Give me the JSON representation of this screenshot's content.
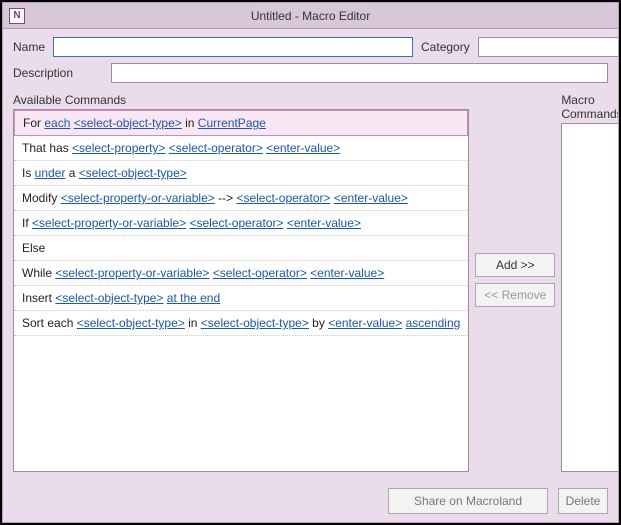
{
  "window": {
    "title": "Untitled - Macro Editor",
    "icon_letter": "N"
  },
  "form": {
    "name_label": "Name",
    "category_label": "Category",
    "description_label": "Description",
    "name_value": "",
    "category_value": "",
    "description_value": ""
  },
  "available_header": "Available Commands",
  "macro_header": "Macro Commands",
  "buttons": {
    "add": "Add >>",
    "remove": "<< Remove",
    "share": "Share on Macroland",
    "delete": "Delete"
  },
  "commands": [
    {
      "selected": true,
      "parts": [
        {
          "t": "text",
          "v": "For "
        },
        {
          "t": "link",
          "v": "each"
        },
        {
          "t": "text",
          "v": " "
        },
        {
          "t": "ph",
          "v": "<select-object-type>"
        },
        {
          "t": "text",
          "v": " in "
        },
        {
          "t": "link",
          "v": "CurrentPage"
        }
      ]
    },
    {
      "parts": [
        {
          "t": "text",
          "v": "That has "
        },
        {
          "t": "ph",
          "v": "<select-property>"
        },
        {
          "t": "text",
          "v": " "
        },
        {
          "t": "ph",
          "v": "<select-operator>"
        },
        {
          "t": "text",
          "v": " "
        },
        {
          "t": "ph",
          "v": "<enter-value>"
        }
      ]
    },
    {
      "parts": [
        {
          "t": "text",
          "v": "Is "
        },
        {
          "t": "link",
          "v": "under"
        },
        {
          "t": "text",
          "v": " a "
        },
        {
          "t": "ph",
          "v": "<select-object-type>"
        }
      ]
    },
    {
      "parts": [
        {
          "t": "text",
          "v": "Modify "
        },
        {
          "t": "ph",
          "v": "<select-property-or-variable>"
        },
        {
          "t": "text",
          "v": " --> "
        },
        {
          "t": "ph",
          "v": "<select-operator>"
        },
        {
          "t": "text",
          "v": " "
        },
        {
          "t": "ph",
          "v": "<enter-value>"
        }
      ]
    },
    {
      "parts": [
        {
          "t": "text",
          "v": "If "
        },
        {
          "t": "ph",
          "v": "<select-property-or-variable>"
        },
        {
          "t": "text",
          "v": " "
        },
        {
          "t": "ph",
          "v": "<select-operator>"
        },
        {
          "t": "text",
          "v": " "
        },
        {
          "t": "ph",
          "v": "<enter-value>"
        }
      ]
    },
    {
      "parts": [
        {
          "t": "text",
          "v": "Else"
        }
      ]
    },
    {
      "parts": [
        {
          "t": "text",
          "v": "While "
        },
        {
          "t": "ph",
          "v": "<select-property-or-variable>"
        },
        {
          "t": "text",
          "v": " "
        },
        {
          "t": "ph",
          "v": "<select-operator>"
        },
        {
          "t": "text",
          "v": " "
        },
        {
          "t": "ph",
          "v": "<enter-value>"
        }
      ]
    },
    {
      "parts": [
        {
          "t": "text",
          "v": "Insert "
        },
        {
          "t": "ph",
          "v": "<select-object-type>"
        },
        {
          "t": "text",
          "v": " "
        },
        {
          "t": "link",
          "v": "at the end"
        }
      ]
    },
    {
      "parts": [
        {
          "t": "text",
          "v": "Sort each "
        },
        {
          "t": "ph",
          "v": "<select-object-type>"
        },
        {
          "t": "text",
          "v": " in "
        },
        {
          "t": "ph",
          "v": "<select-object-type>"
        },
        {
          "t": "text",
          "v": " by "
        },
        {
          "t": "ph",
          "v": "<enter-value>"
        },
        {
          "t": "text",
          "v": " "
        },
        {
          "t": "link",
          "v": "ascending"
        }
      ]
    }
  ]
}
